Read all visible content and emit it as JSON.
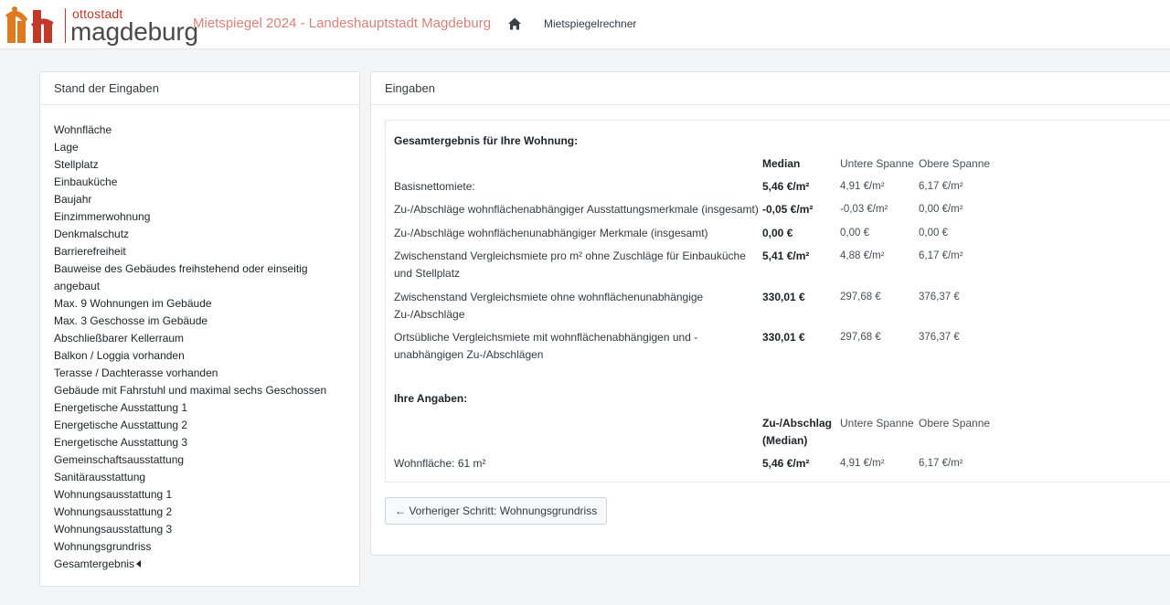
{
  "header": {
    "logo_small": "ottostadt",
    "logo_big": "magdeburg",
    "app_title": "Mietspiegel 2024 - Landeshauptstadt Magdeburg",
    "home_icon": "home-icon",
    "nav_link": "Mietspiegelrechner"
  },
  "sidebar": {
    "title": "Stand der Eingaben",
    "items": [
      "Wohnfläche",
      "Lage",
      "Stellplatz",
      "Einbauküche",
      "Baujahr",
      "Einzimmerwohnung",
      "Denkmalschutz",
      "Barrierefreiheit",
      "Bauweise des Gebäudes freihstehend oder einseitig",
      "angebaut",
      "Max. 9 Wohnungen im Gebäude",
      "Max. 3 Geschosse im Gebäude",
      "Abschließbarer Kellerraum",
      "Balkon / Loggia vorhanden",
      "Terasse / Dachterasse vorhanden",
      "Gebäude mit Fahrstuhl und maximal sechs Geschossen",
      "Energetische Ausstattung 1",
      "Energetische Ausstattung 2",
      "Energetische Ausstattung 3",
      "Gemeinschaftsausstattung",
      "Sanitärausstattung",
      "Wohnungsausstattung 1",
      "Wohnungsausstattung 2",
      "Wohnungsausstattung 3",
      "Wohnungsgrundriss"
    ],
    "current": "Gesamtergebnis"
  },
  "main": {
    "title": "Eingaben",
    "result_title": "Gesamtergebnis für Ihre Wohnung:",
    "columns": {
      "median": "Median",
      "lower": "Untere Spanne",
      "upper": "Obere Spanne"
    },
    "rows": [
      {
        "label": "Basisnettomiete:",
        "median": "5,46 €/m²",
        "lower": "4,91 €/m²",
        "upper": "6,17 €/m²"
      },
      {
        "label": "Zu-/Abschläge wohnflächenabhängiger Ausstattungsmerkmale (insgesamt)",
        "median": "-0,05 €/m²",
        "lower": "-0,03 €/m²",
        "upper": "0,00 €/m²"
      },
      {
        "label": "Zu-/Abschläge wohnflächenunabhängiger Merkmale (insgesamt)",
        "median": "0,00 €",
        "lower": "0,00 €",
        "upper": "0,00 €"
      },
      {
        "label": "Zwischenstand Vergleichsmiete pro m² ohne Zuschläge für Einbauküche und Stellplatz",
        "median": "5,41 €/m²",
        "lower": "4,88 €/m²",
        "upper": "6,17 €/m²"
      },
      {
        "label": "Zwischenstand Vergleichsmiete ohne wohnflächenunabhängige Zu-/Abschläge",
        "median": "330,01 €",
        "lower": "297,68 €",
        "upper": "376,37 €"
      },
      {
        "label": "Ortsübliche Vergleichsmiete mit wohnflächenabhängigen und -unabhängigen Zu-/Abschlägen",
        "median": "330,01 €",
        "lower": "297,68 €",
        "upper": "376,37 €"
      }
    ],
    "inputs_title": "Ihre Angaben:",
    "input_columns": {
      "median": "Zu-/Abschlag (Median)",
      "lower": "Untere Spanne",
      "upper": "Obere Spanne"
    },
    "input_rows": [
      {
        "label": "Wohnfläche: 61 m²",
        "median": "5,46 €/m²",
        "lower": "4,91 €/m²",
        "upper": "6,17 €/m²"
      }
    ],
    "prev_button": "← Vorheriger Schritt: Wohnungsgrundriss"
  }
}
